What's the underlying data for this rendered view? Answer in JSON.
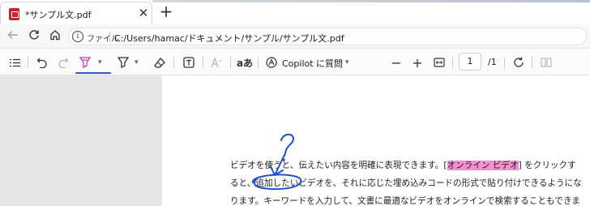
{
  "tab": {
    "title": "*サンプル文.pdf",
    "close_glyph": "✕",
    "new_tab_glyph": "+"
  },
  "address": {
    "label": "ファイル",
    "url": "C:/Users/hamac/ドキュメント/サンプル/サンプル文.pdf"
  },
  "toolbar": {
    "copilot_label": "Copilot に質問",
    "page_current": "1",
    "page_total": "/1",
    "read_aloud_label": "aあ"
  },
  "document": {
    "line1_before": "ビデオを使うと、伝えたい内容を明確に表現できます。[",
    "line1_highlight": "オンライン ビデオ",
    "line1_after": "] をクリックす",
    "line2_before": "ると、",
    "line2_circled": "追加したい",
    "line2_after": "ビデオを、それに応じた埋め込みコードの形式で貼り付けできるようにな",
    "line3": "ります。キーワードを入力して、文書に最適なビデオをオンラインで検索することもできま"
  },
  "colors": {
    "highlight_pink": "#f48fd0",
    "ink_blue": "#1f4fc9",
    "pdf_icon_red": "#c4262e",
    "active_underline": "#2b5fbf"
  },
  "icons": [
    "pdf-file-icon",
    "back-arrow-icon",
    "reload-icon",
    "home-icon",
    "info-icon",
    "contents-list-icon",
    "undo-icon",
    "redo-icon",
    "highlighter-icon",
    "draw-icon",
    "eraser-icon",
    "text-box-icon",
    "text-size-icon",
    "read-aloud-icon",
    "copilot-icon",
    "zoom-out-icon",
    "zoom-in-icon",
    "fit-page-icon",
    "rotate-icon",
    "two-page-icon"
  ]
}
